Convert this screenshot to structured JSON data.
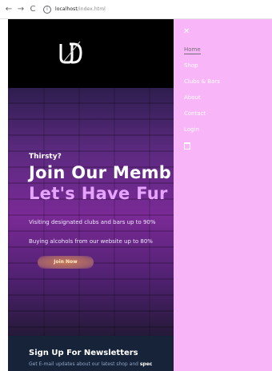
{
  "browser": {
    "url_host": "localhost",
    "url_path": "/index.html"
  },
  "hero": {
    "eyebrow": "Thirsty?",
    "title_line1": "Join Our Memb",
    "title_line2": "Let's Have Fur",
    "line1": "Visiting designated clubs and bars up to 90%",
    "line2": "Buying alcohols from our website up to 80%",
    "cta": "Join Now"
  },
  "newsletter": {
    "title": "Sign Up For Newsletters",
    "subtitle": "Get E-mail updates about our latest shop and",
    "subtitle_bold": "spec"
  },
  "menu": {
    "items": [
      {
        "label": "Home"
      },
      {
        "label": "Shop"
      },
      {
        "label": "Clubs & Bars"
      },
      {
        "label": "About"
      },
      {
        "label": "Contact"
      },
      {
        "label": "Login"
      }
    ]
  },
  "icons": {
    "close": "close-icon",
    "bag": "shopping-bag-icon",
    "logo": "brand-logo"
  },
  "colors": {
    "menu_bg": "#f8b6f8",
    "accent_title": "#e7a4ff",
    "newsletter_bg": "#172338"
  }
}
